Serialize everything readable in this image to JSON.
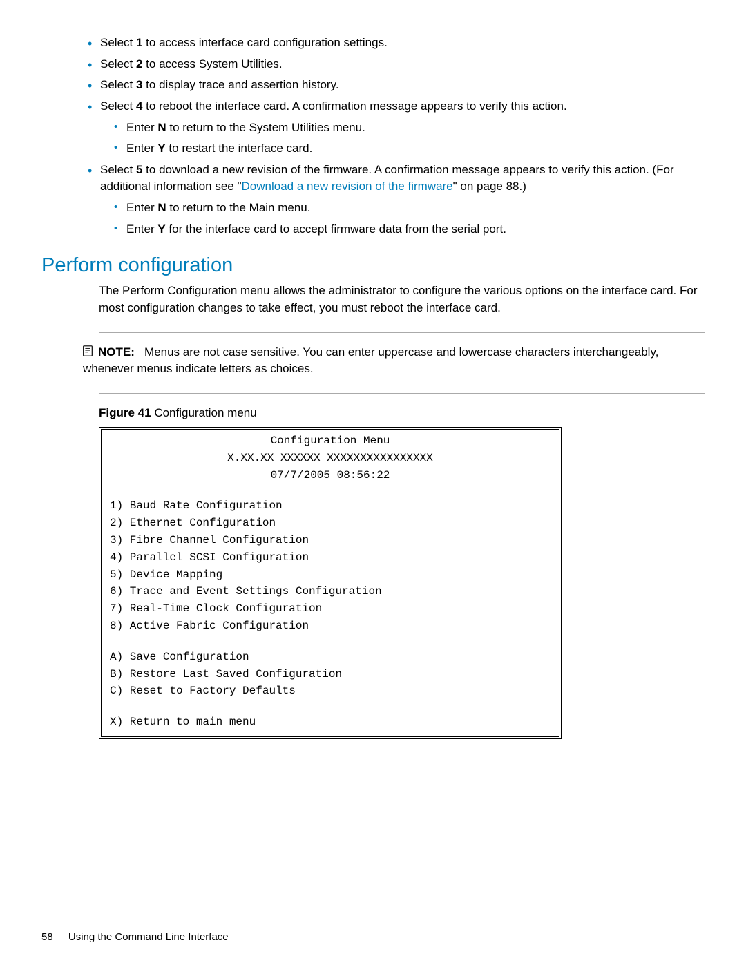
{
  "bullets": {
    "b1": {
      "pre": "Select ",
      "kw": "1",
      "post": " to access interface card configuration settings."
    },
    "b2": {
      "pre": "Select ",
      "kw": "2",
      "post": " to access System Utilities."
    },
    "b3": {
      "pre": "Select ",
      "kw": "3",
      "post": " to display trace and assertion history."
    },
    "b4": {
      "pre": "Select ",
      "kw": "4",
      "post": " to reboot the interface card. A confirmation message appears to verify this action."
    },
    "b4a": {
      "pre": "Enter ",
      "kw": "N",
      "post": " to return to the System Utilities menu."
    },
    "b4b": {
      "pre": "Enter ",
      "kw": "Y",
      "post": " to restart the interface card."
    },
    "b5": {
      "pre": "Select ",
      "kw": "5",
      "post_a": " to download a new revision of the firmware. A confirmation message appears to verify this action. (For additional information see \"",
      "link": "Download a new revision of the firmware",
      "post_b": "\" on page 88.)"
    },
    "b5a": {
      "pre": "Enter ",
      "kw": "N",
      "post": " to return to the Main menu."
    },
    "b5b": {
      "pre": "Enter ",
      "kw": "Y",
      "post": " for the interface card to accept firmware data from the serial port."
    }
  },
  "section_title": "Perform configuration",
  "section_body": "The Perform Configuration menu allows the administrator to configure the various options on the interface card. For most configuration changes to take effect, you must reboot the interface card.",
  "note": {
    "label": "NOTE:",
    "text": "   Menus are not case sensitive. You can enter uppercase and lowercase characters interchangeably, whenever menus indicate letters as choices."
  },
  "figure": {
    "label": "Figure 41",
    "caption": " Configuration menu"
  },
  "menu": {
    "title": "Configuration Menu",
    "version": "X.XX.XX  XXXXXX  XXXXXXXXXXXXXXXX",
    "timestamp": "07/7/2005  08:56:22",
    "items1": [
      "1) Baud Rate Configuration",
      "2) Ethernet Configuration",
      "3) Fibre Channel Configuration",
      "4) Parallel SCSI Configuration",
      "5) Device Mapping",
      "6) Trace and Event Settings Configuration",
      "7) Real-Time Clock Configuration",
      "8) Active Fabric Configuration"
    ],
    "items2": [
      "A) Save Configuration",
      "B) Restore Last Saved Configuration",
      "C) Reset to Factory Defaults"
    ],
    "items3": [
      "X) Return to main menu"
    ]
  },
  "footer": {
    "page": "58",
    "chapter": "Using the Command Line Interface"
  }
}
